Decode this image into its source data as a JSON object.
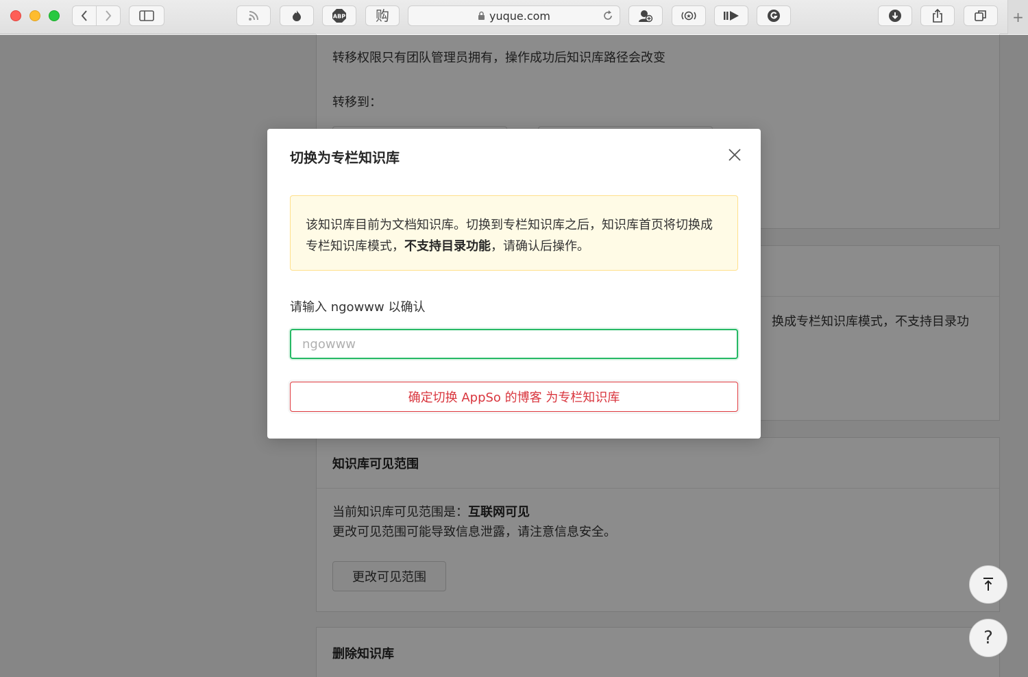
{
  "browser": {
    "url": "yuque.com",
    "new_tab_glyph": "+"
  },
  "page": {
    "transfer_card": {
      "description": "转移权限只有团队管理员拥有，操作成功后知识库路径会改变",
      "transfer_to_label": "转移到："
    },
    "switch_card": {
      "partial_text": "换成专栏知识库模式，不支持目录功"
    },
    "visibility_card": {
      "title": "知识库可见范围",
      "current_prefix": "当前知识库可见范围是：",
      "current_value": "互联网可见",
      "warning_text": "更改可见范围可能导致信息泄露，请注意信息安全。",
      "change_button": "更改可见范围"
    },
    "delete_card": {
      "title": "删除知识库"
    },
    "float": {
      "back_top_icon": "arrow-up-to-line-icon",
      "help_label": "?"
    }
  },
  "modal": {
    "title": "切换为专栏知识库",
    "warning": {
      "part1": "该知识库目前为文档知识库。切换到专栏知识库之后，知识库首页将切换成专栏知识库模式，",
      "bold": "不支持目录功能",
      "part2": "，请确认后操作。"
    },
    "confirm_label": "请输入 ngowww 以确认",
    "input_placeholder": "ngowww",
    "input_value": "",
    "confirm_button": "确定切换 AppSo 的博客 为专栏知识库"
  },
  "colors": {
    "accent_green": "#25b864",
    "danger_red": "#d9363e",
    "warning_bg": "#fffbe6"
  }
}
